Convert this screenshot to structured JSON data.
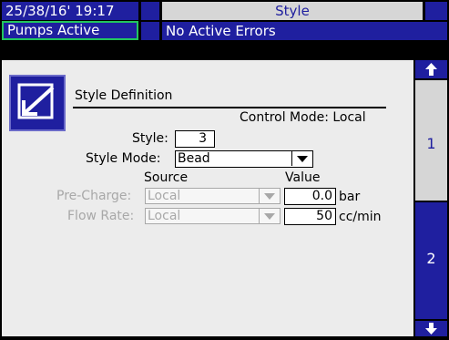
{
  "header": {
    "datetime": "25/38/16' 19:17",
    "screen_title": "Style",
    "status": "Pumps Active",
    "errors": "No Active Errors"
  },
  "tabs": {
    "up_arrow": "up-arrow-icon",
    "tab1_label": "1",
    "tab2_label": "2",
    "down_arrow": "down-arrow-icon"
  },
  "section": {
    "title": "Style Definition",
    "control_mode": "Control Mode: Local"
  },
  "form": {
    "style_label": "Style:",
    "style_value": "3",
    "style_mode_label": "Style Mode:",
    "style_mode_value": "Bead",
    "source_header": "Source",
    "value_header": "Value",
    "pre_charge_label": "Pre-Charge:",
    "pre_charge_source": "Local",
    "pre_charge_value": "0.0",
    "pre_charge_unit": "bar",
    "flow_rate_label": "Flow Rate:",
    "flow_rate_source": "Local",
    "flow_rate_value": "50",
    "flow_rate_unit": "cc/min"
  },
  "colors": {
    "header_blue": "#1f1f9f",
    "active_green": "#22c55e",
    "panel_bg": "#ececec"
  }
}
